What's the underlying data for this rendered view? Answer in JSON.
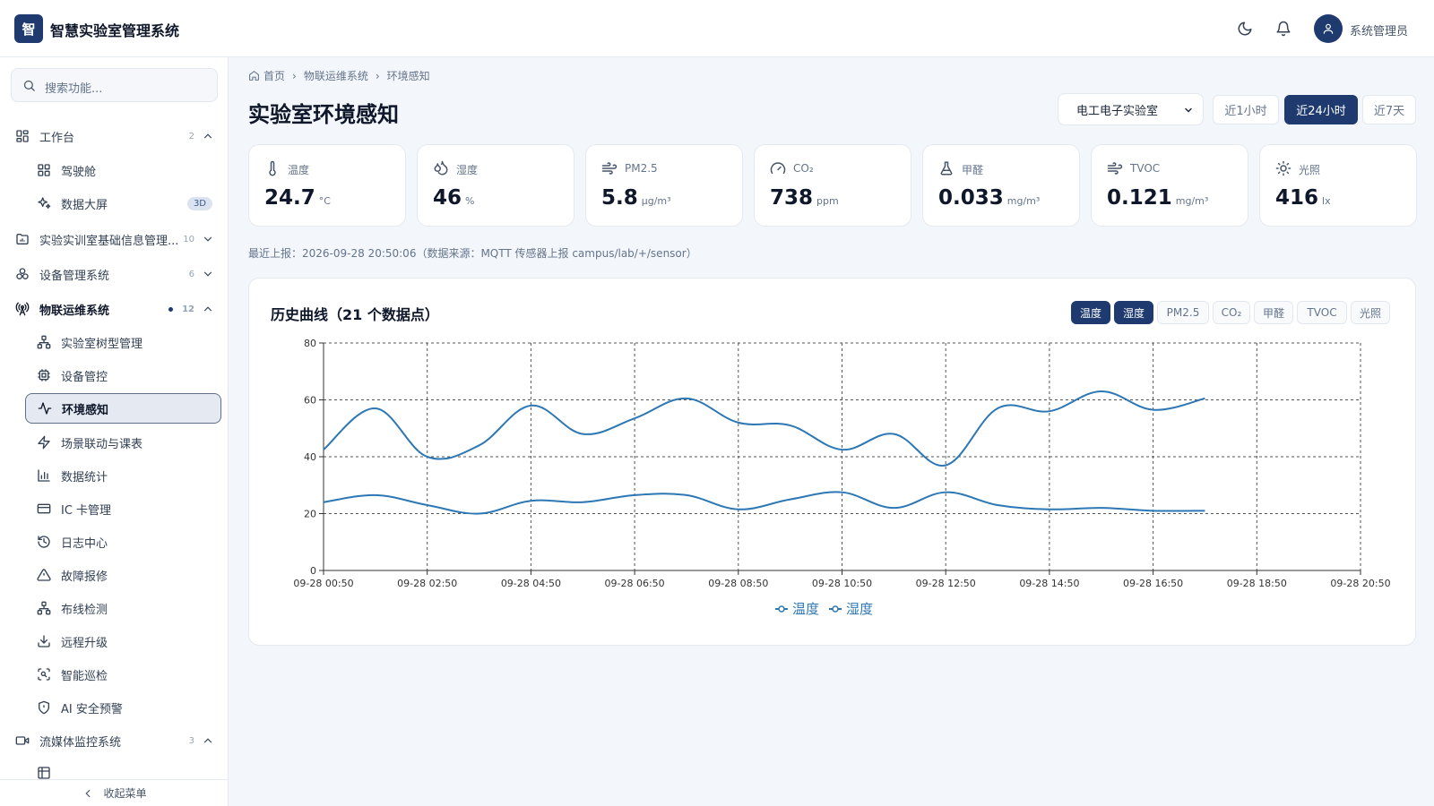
{
  "header": {
    "logo_char": "智",
    "app_title": "智慧实验室管理系统",
    "user_name": "系统管理员"
  },
  "sidebar": {
    "search_placeholder": "搜索功能...",
    "groups": [
      {
        "label": "工作台",
        "count": "2"
      },
      {
        "label": "实验实训室基础信息管理...",
        "count": "10"
      },
      {
        "label": "设备管理系统",
        "count": "6"
      },
      {
        "label": "物联运维系统",
        "count": "12"
      },
      {
        "label": "流媒体监控系统",
        "count": "3"
      }
    ],
    "workbench_items": [
      {
        "label": "驾驶舱"
      },
      {
        "label": "数据大屏",
        "badge": "3D"
      }
    ],
    "iot_items": [
      {
        "label": "实验室树型管理"
      },
      {
        "label": "设备管控"
      },
      {
        "label": "环境感知"
      },
      {
        "label": "场景联动与课表"
      },
      {
        "label": "数据统计"
      },
      {
        "label": "IC 卡管理"
      },
      {
        "label": "日志中心"
      },
      {
        "label": "故障报修"
      },
      {
        "label": "布线检测"
      },
      {
        "label": "远程升级"
      },
      {
        "label": "智能巡检"
      },
      {
        "label": "AI 安全预警"
      }
    ],
    "collapse_label": "收起菜单"
  },
  "breadcrumb": {
    "home": "首页",
    "level1": "物联运维系统",
    "level2": "环境感知"
  },
  "page_title": "实验室环境感知",
  "lab_select": {
    "value": "电工电子实验室"
  },
  "ranges": [
    {
      "label": "近1小时"
    },
    {
      "label": "近24小时",
      "selected": true
    },
    {
      "label": "近7天"
    }
  ],
  "metrics": [
    {
      "label": "温度",
      "value": "24.7",
      "unit": "°C",
      "icon": "thermometer-icon"
    },
    {
      "label": "湿度",
      "value": "46",
      "unit": "%",
      "icon": "droplets-icon"
    },
    {
      "label": "PM2.5",
      "value": "5.8",
      "unit": "μg/m³",
      "icon": "wind-icon"
    },
    {
      "label": "CO₂",
      "value": "738",
      "unit": "ppm",
      "icon": "gauge-icon"
    },
    {
      "label": "甲醛",
      "value": "0.033",
      "unit": "mg/m³",
      "icon": "flask-icon"
    },
    {
      "label": "TVOC",
      "value": "0.121",
      "unit": "mg/m³",
      "icon": "wind-icon"
    },
    {
      "label": "光照",
      "value": "416",
      "unit": "lx",
      "icon": "sun-icon"
    }
  ],
  "report_line": "最近上报：2026-09-28 20:50:06（数据来源：MQTT 传感器上报 campus/lab/+/sensor）",
  "chart": {
    "title": "历史曲线（21 个数据点）",
    "chips": [
      {
        "label": "温度",
        "on": true
      },
      {
        "label": "湿度",
        "on": true
      },
      {
        "label": "PM2.5",
        "on": false
      },
      {
        "label": "CO₂",
        "on": false
      },
      {
        "label": "甲醛",
        "on": false
      },
      {
        "label": "TVOC",
        "on": false
      },
      {
        "label": "光照",
        "on": false
      }
    ]
  },
  "chart_data": {
    "type": "line",
    "x": [
      "09-28 00:50",
      "09-28 01:50",
      "09-28 02:50",
      "09-28 03:50",
      "09-28 04:50",
      "09-28 05:50",
      "09-28 06:50",
      "09-28 07:50",
      "09-28 08:50",
      "09-28 09:50",
      "09-28 10:50",
      "09-28 11:50",
      "09-28 12:50",
      "09-28 13:50",
      "09-28 14:50",
      "09-28 15:50",
      "09-28 16:50",
      "09-28 17:50",
      "09-28 18:50",
      "09-28 19:50",
      "09-28 20:50"
    ],
    "x_ticks": [
      "09-28 00:50",
      "09-28 02:50",
      "09-28 04:50",
      "09-28 06:50",
      "09-28 08:50",
      "09-28 10:50",
      "09-28 12:50",
      "09-28 14:50",
      "09-28 16:50",
      "09-28 18:50",
      "09-28 20:50"
    ],
    "ylim": [
      0,
      80
    ],
    "y_ticks": [
      0,
      20,
      40,
      60,
      80
    ],
    "grid": true,
    "legend": "bottom-center",
    "series": [
      {
        "name": "温度",
        "color": "#2c77b4",
        "values": [
          24.0,
          26.5,
          23.0,
          20.0,
          24.5,
          24.0,
          26.5,
          26.5,
          21.5,
          25.0,
          27.5,
          22.0,
          27.5,
          23.0,
          21.5,
          22.0,
          21.0,
          21.0
        ]
      },
      {
        "name": "湿度",
        "color": "#2c77b4",
        "values": [
          42.5,
          57.0,
          40.0,
          44.0,
          58.0,
          48.0,
          53.5,
          60.5,
          52.0,
          51.0,
          42.5,
          48.0,
          37.0,
          57.0,
          56.0,
          63.0,
          56.5,
          60.5
        ]
      }
    ]
  }
}
